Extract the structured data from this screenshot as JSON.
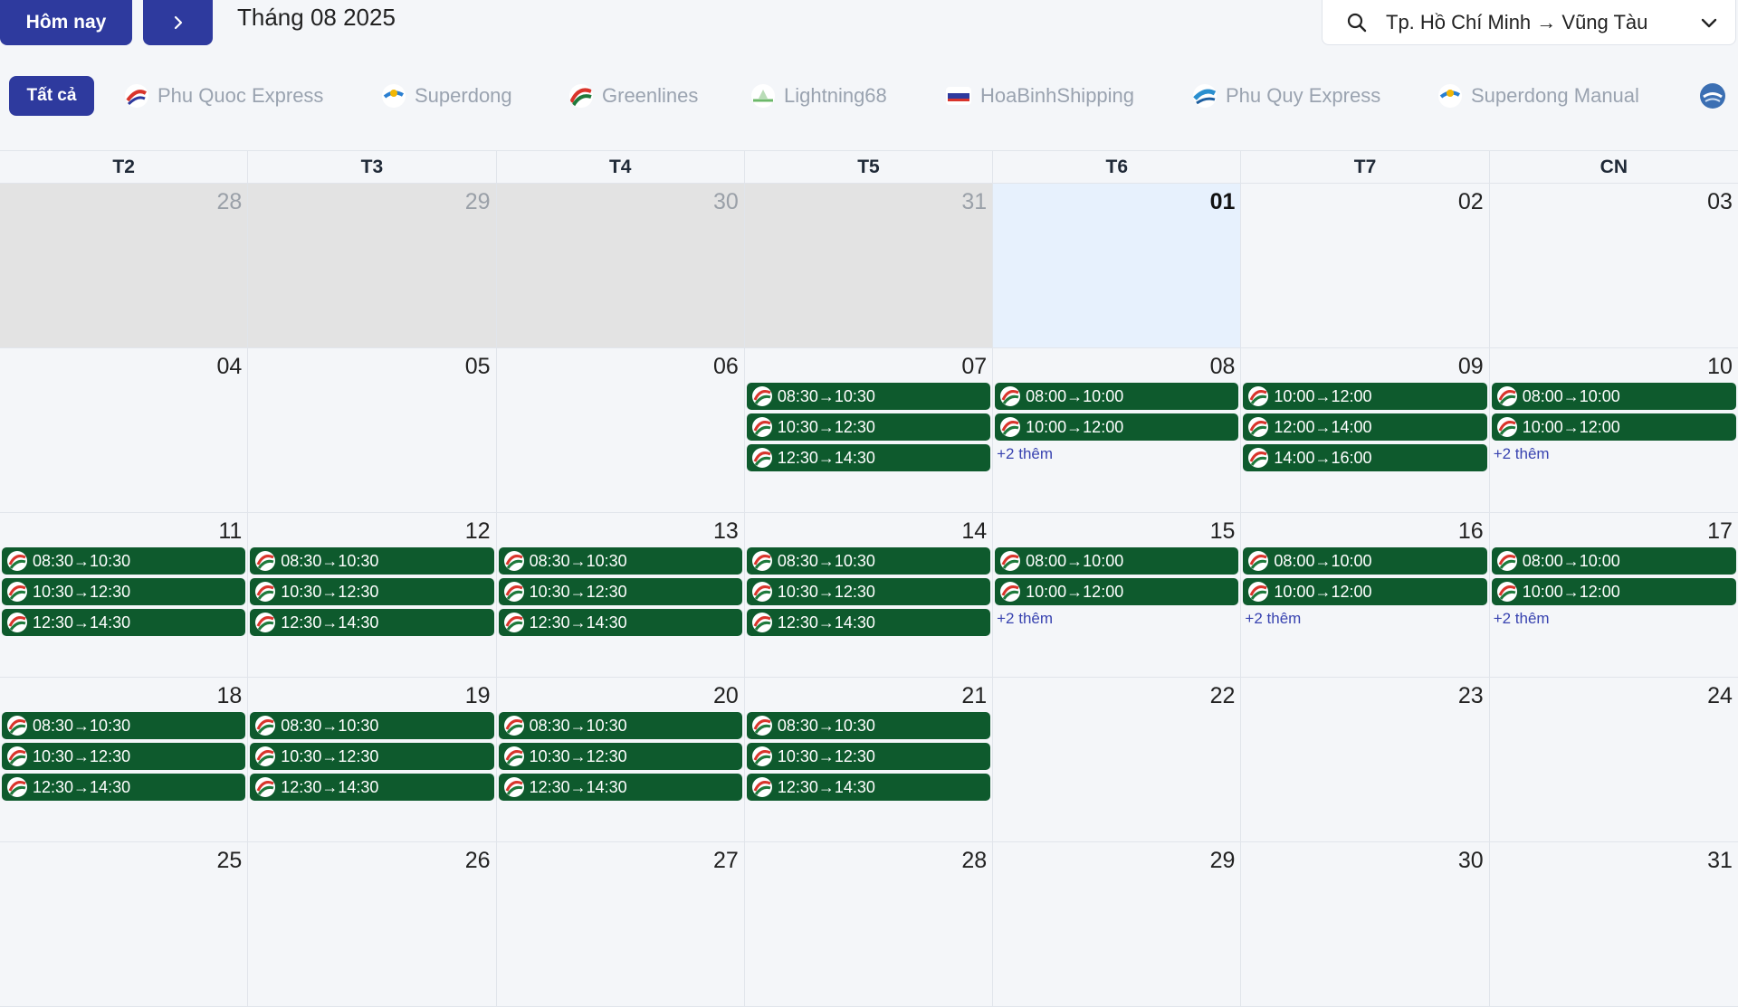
{
  "header": {
    "today_label": "Hôm nay",
    "next_icon": "chevron-right-icon",
    "month_title": "Tháng 08 2025",
    "route": "Tp. Hồ Chí Minh → Vũng Tàu",
    "search_icon": "search-icon",
    "dropdown_icon": "chevron-down-icon"
  },
  "filters": {
    "all_label": "Tất cả",
    "operators": [
      {
        "name": "Phu Quoc Express",
        "color": "#d9342b"
      },
      {
        "name": "Superdong",
        "color": "#2a7fd1"
      },
      {
        "name": "Greenlines",
        "color": "#1e7a3c"
      },
      {
        "name": "Lightning68",
        "color": "#6cb86a"
      },
      {
        "name": "HoaBinhShipping",
        "color": "#2e3a9e"
      },
      {
        "name": "Phu Quy Express",
        "color": "#2a8fcf"
      },
      {
        "name": "Superdong Manual",
        "color": "#2a7fd1"
      },
      {
        "name": "",
        "color": "#3b6fb3"
      }
    ]
  },
  "calendar": {
    "weekdays": [
      "T2",
      "T3",
      "T4",
      "T5",
      "T6",
      "T7",
      "CN"
    ],
    "event_color": "#0e5a2d",
    "weeks": [
      [
        {
          "day": "28",
          "other": true,
          "events": [],
          "more": ""
        },
        {
          "day": "29",
          "other": true,
          "events": [],
          "more": ""
        },
        {
          "day": "30",
          "other": true,
          "events": [],
          "more": ""
        },
        {
          "day": "31",
          "other": true,
          "events": [],
          "more": ""
        },
        {
          "day": "01",
          "today": true,
          "events": [],
          "more": ""
        },
        {
          "day": "02",
          "events": [],
          "more": ""
        },
        {
          "day": "03",
          "events": [],
          "more": ""
        }
      ],
      [
        {
          "day": "04",
          "events": [],
          "more": ""
        },
        {
          "day": "05",
          "events": [],
          "more": ""
        },
        {
          "day": "06",
          "events": [],
          "more": ""
        },
        {
          "day": "07",
          "events": [
            "08:30→10:30",
            "10:30→12:30",
            "12:30→14:30"
          ],
          "more": ""
        },
        {
          "day": "08",
          "events": [
            "08:00→10:00",
            "10:00→12:00"
          ],
          "more": "+2 thêm"
        },
        {
          "day": "09",
          "events": [
            "10:00→12:00",
            "12:00→14:00",
            "14:00→16:00"
          ],
          "more": ""
        },
        {
          "day": "10",
          "events": [
            "08:00→10:00",
            "10:00→12:00"
          ],
          "more": "+2 thêm"
        }
      ],
      [
        {
          "day": "11",
          "events": [
            "08:30→10:30",
            "10:30→12:30",
            "12:30→14:30"
          ],
          "more": ""
        },
        {
          "day": "12",
          "events": [
            "08:30→10:30",
            "10:30→12:30",
            "12:30→14:30"
          ],
          "more": ""
        },
        {
          "day": "13",
          "events": [
            "08:30→10:30",
            "10:30→12:30",
            "12:30→14:30"
          ],
          "more": ""
        },
        {
          "day": "14",
          "events": [
            "08:30→10:30",
            "10:30→12:30",
            "12:30→14:30"
          ],
          "more": ""
        },
        {
          "day": "15",
          "events": [
            "08:00→10:00",
            "10:00→12:00"
          ],
          "more": "+2 thêm"
        },
        {
          "day": "16",
          "events": [
            "08:00→10:00",
            "10:00→12:00"
          ],
          "more": "+2 thêm"
        },
        {
          "day": "17",
          "events": [
            "08:00→10:00",
            "10:00→12:00"
          ],
          "more": "+2 thêm"
        }
      ],
      [
        {
          "day": "18",
          "events": [
            "08:30→10:30",
            "10:30→12:30",
            "12:30→14:30"
          ],
          "more": ""
        },
        {
          "day": "19",
          "events": [
            "08:30→10:30",
            "10:30→12:30",
            "12:30→14:30"
          ],
          "more": ""
        },
        {
          "day": "20",
          "events": [
            "08:30→10:30",
            "10:30→12:30",
            "12:30→14:30"
          ],
          "more": ""
        },
        {
          "day": "21",
          "events": [
            "08:30→10:30",
            "10:30→12:30",
            "12:30→14:30"
          ],
          "more": ""
        },
        {
          "day": "22",
          "events": [],
          "more": ""
        },
        {
          "day": "23",
          "events": [],
          "more": ""
        },
        {
          "day": "24",
          "events": [],
          "more": ""
        }
      ],
      [
        {
          "day": "25",
          "events": [],
          "more": ""
        },
        {
          "day": "26",
          "events": [],
          "more": ""
        },
        {
          "day": "27",
          "events": [],
          "more": ""
        },
        {
          "day": "28",
          "events": [],
          "more": ""
        },
        {
          "day": "29",
          "events": [],
          "more": ""
        },
        {
          "day": "30",
          "events": [],
          "more": ""
        },
        {
          "day": "31",
          "events": [],
          "more": ""
        }
      ]
    ]
  }
}
